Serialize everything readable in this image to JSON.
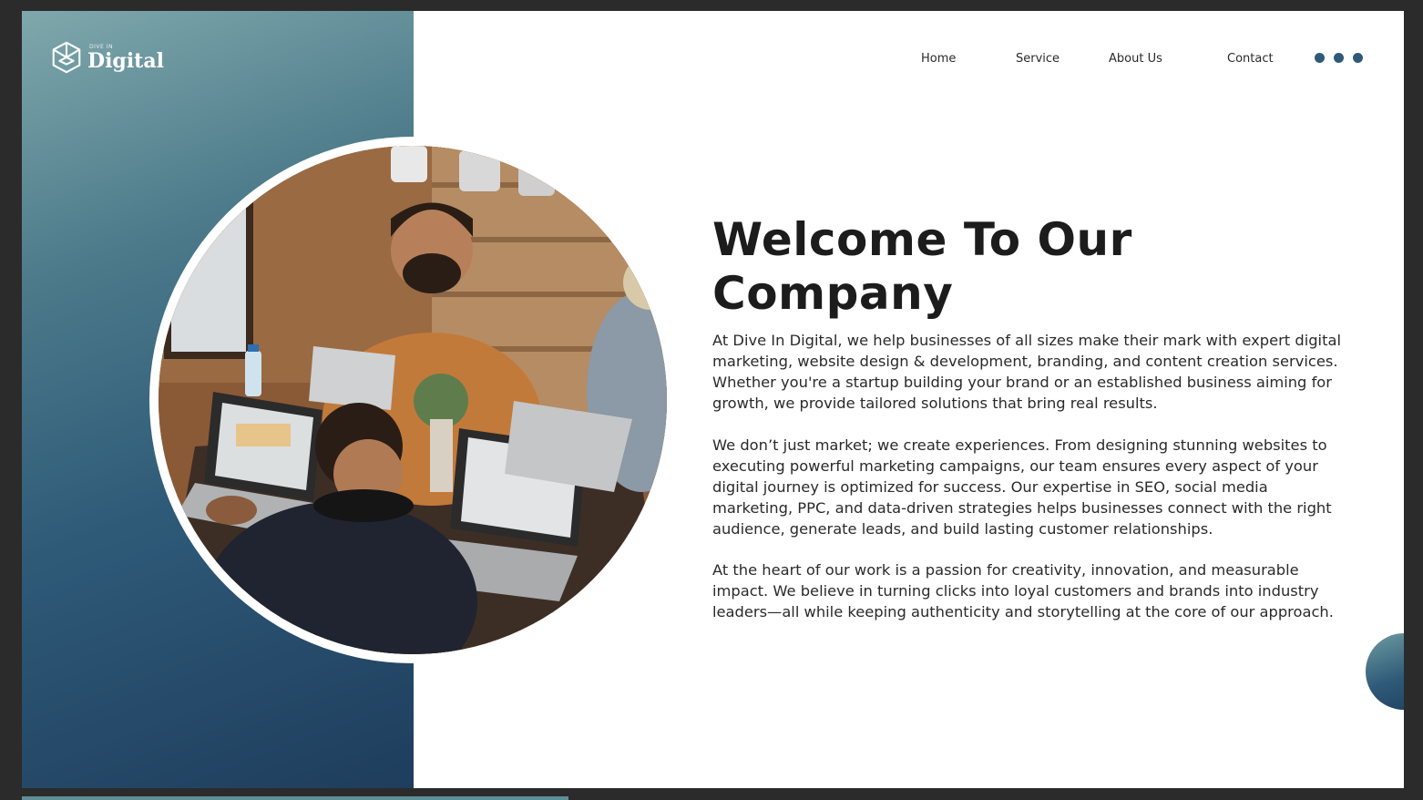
{
  "logo": {
    "small_text": "DIVE IN",
    "big_text": "Digital",
    "icon": "cube-logo-icon"
  },
  "nav": {
    "items": [
      "Home",
      "Service",
      "About Us",
      "Contact"
    ],
    "menu_icon": "three-dots-icon"
  },
  "hero": {
    "title_line1": "Welcome To Our",
    "title_line2": "Company",
    "paragraphs": [
      "At Dive In Digital, we help businesses of all sizes make their mark with expert digital marketing, website design & development, branding, and content creation services. Whether you're a startup building your brand or an established business aiming for growth, we provide tailored solutions that bring real results.",
      "We don’t just market; we create experiences. From designing stunning websites to executing powerful marketing campaigns, our team ensures every aspect of your digital journey is optimized for success. Our expertise in SEO, social media marketing, PPC, and data-driven strategies helps businesses connect with the right audience, generate leads, and build lasting customer relationships.",
      "At the heart of our work is a passion for creativity, innovation, and measurable impact. We believe in turning clicks into loyal customers and brands into industry leaders—all while keeping authenticity and storytelling at the core of our approach."
    ]
  },
  "colors": {
    "brand_dark": "#1f3d5d",
    "brand_teal": "#7fa8ac",
    "text": "#1c1c1c"
  }
}
